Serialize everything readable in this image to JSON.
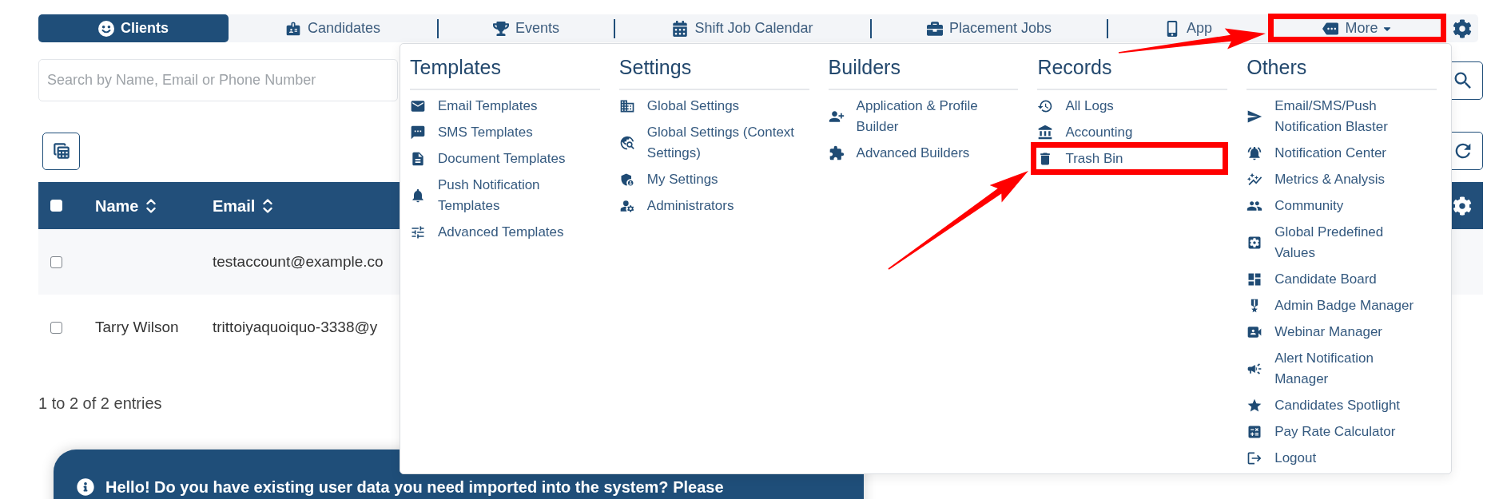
{
  "nav": {
    "tabs": [
      {
        "label": "Clients",
        "kind": "link",
        "selected": true,
        "highlighted": false
      },
      {
        "label": "Candidates",
        "kind": "link",
        "selected": false,
        "highlighted": false
      },
      {
        "label": "Events",
        "kind": "link",
        "selected": false,
        "highlighted": false
      },
      {
        "label": "Shift Job Calendar",
        "kind": "link",
        "selected": false,
        "highlighted": false
      },
      {
        "label": "Placement Jobs",
        "kind": "link",
        "selected": false,
        "highlighted": false
      },
      {
        "label": "App",
        "kind": "link",
        "selected": false,
        "highlighted": false
      },
      {
        "label": "More",
        "kind": "dropdown",
        "selected": false,
        "highlighted": true
      }
    ]
  },
  "more_menu": {
    "columns": [
      {
        "title": "Templates",
        "items": [
          {
            "label": "Email Templates",
            "highlighted": false
          },
          {
            "label": "SMS Templates",
            "highlighted": false
          },
          {
            "label": "Document Templates",
            "highlighted": false
          },
          {
            "label": "Push Notification Templates",
            "highlighted": false
          },
          {
            "label": "Advanced Templates",
            "highlighted": false
          }
        ]
      },
      {
        "title": "Settings",
        "items": [
          {
            "label": "Global Settings",
            "highlighted": false
          },
          {
            "label": "Global Settings (Context Settings)",
            "highlighted": false
          },
          {
            "label": "My Settings",
            "highlighted": false
          },
          {
            "label": "Administrators",
            "highlighted": false
          }
        ]
      },
      {
        "title": "Builders",
        "items": [
          {
            "label": "Application & Profile Builder",
            "highlighted": false
          },
          {
            "label": "Advanced Builders",
            "highlighted": false
          }
        ]
      },
      {
        "title": "Records",
        "items": [
          {
            "label": "All Logs",
            "highlighted": false
          },
          {
            "label": "Accounting",
            "highlighted": false
          },
          {
            "label": "Trash Bin",
            "highlighted": true
          }
        ]
      },
      {
        "title": "Others",
        "items": [
          {
            "label": "Email/SMS/Push Notification Blaster",
            "highlighted": false
          },
          {
            "label": "Notification Center",
            "highlighted": false
          },
          {
            "label": "Metrics & Analysis",
            "highlighted": false
          },
          {
            "label": "Community",
            "highlighted": false
          },
          {
            "label": "Global Predefined Values",
            "highlighted": false
          },
          {
            "label": "Candidate Board",
            "highlighted": false
          },
          {
            "label": "Admin Badge Manager",
            "highlighted": false
          },
          {
            "label": "Webinar Manager",
            "highlighted": false
          },
          {
            "label": "Alert Notification Manager",
            "highlighted": false
          },
          {
            "label": "Candidates Spotlight",
            "highlighted": false
          },
          {
            "label": "Pay Rate Calculator",
            "highlighted": false
          },
          {
            "label": "Logout",
            "highlighted": false
          }
        ]
      }
    ]
  },
  "search": {
    "placeholder": "Search by Name, Email or Phone Number"
  },
  "table": {
    "select_all_checked": false,
    "columns": [
      {
        "label": "Name"
      },
      {
        "label": "Email"
      }
    ],
    "rows": [
      {
        "checked": false,
        "email": "testaccount@example.co"
      },
      {
        "checked": false,
        "name": "Tarry Wilson",
        "email": "trittoiyaquoiquo-3338@y"
      }
    ]
  },
  "pagination": {
    "summary": "1 to 2 of 2 entries"
  },
  "banner": {
    "text": "Hello! Do you have existing user data you need imported into the system? Please"
  }
}
